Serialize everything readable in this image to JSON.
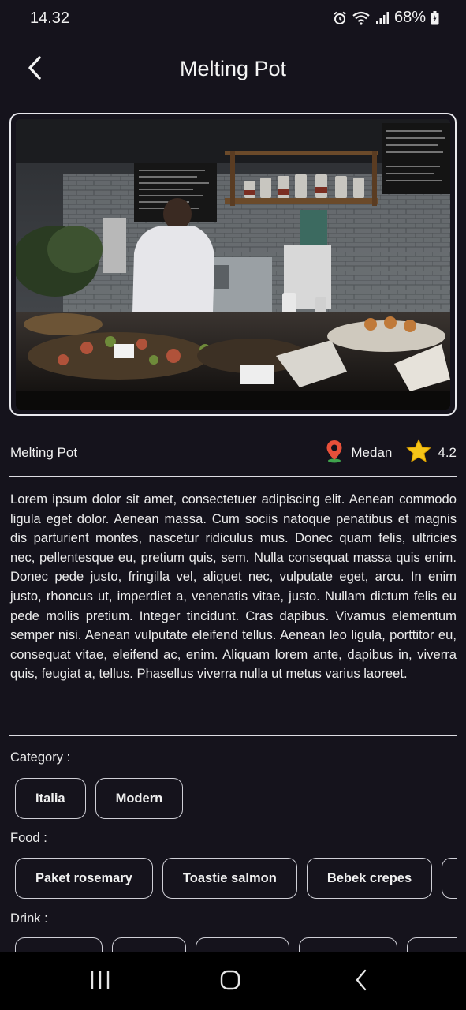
{
  "status_bar": {
    "time": "14.32",
    "battery": "68%",
    "icons": [
      "alarm-icon",
      "wifi-icon",
      "signal-icon",
      "battery-icon"
    ]
  },
  "app_bar": {
    "title": "Melting Pot",
    "back_icon": "chevron-left-icon"
  },
  "hero": {
    "description": "restaurant-kitchen-photo"
  },
  "info": {
    "name": "Melting Pot",
    "location": "Medan",
    "location_icon": "map-pin-icon",
    "rating": "4.2",
    "rating_icon": "star-icon"
  },
  "description": "Lorem ipsum dolor sit amet, consectetuer adipiscing elit. Aenean commodo ligula eget dolor. Aenean massa. Cum sociis natoque penatibus et magnis dis parturient montes, nascetur ridiculus mus. Donec quam felis, ultricies nec, pellentesque eu, pretium quis, sem. Nulla consequat massa quis enim. Donec pede justo, fringilla vel, aliquet nec, vulputate eget, arcu. In enim justo, rhoncus ut, imperdiet a, venenatis vitae, justo. Nullam dictum felis eu pede mollis pretium. Integer tincidunt. Cras dapibus. Vivamus elementum semper nisi. Aenean vulputate eleifend tellus. Aenean leo ligula, porttitor eu, consequat vitae, eleifend ac, enim. Aliquam lorem ante, dapibus in, viverra quis, feugiat a, tellus. Phasellus viverra nulla ut metus varius laoreet.",
  "category": {
    "label": "Category :",
    "items": [
      "Italia",
      "Modern"
    ]
  },
  "food": {
    "label": "Food :",
    "items": [
      "Paket rosemary",
      "Toastie salmon",
      "Bebek crepes"
    ]
  },
  "drink": {
    "label": "Drink :"
  },
  "colors": {
    "background": "#15131c",
    "pin": "#e8503a",
    "star": "#f5c518"
  }
}
